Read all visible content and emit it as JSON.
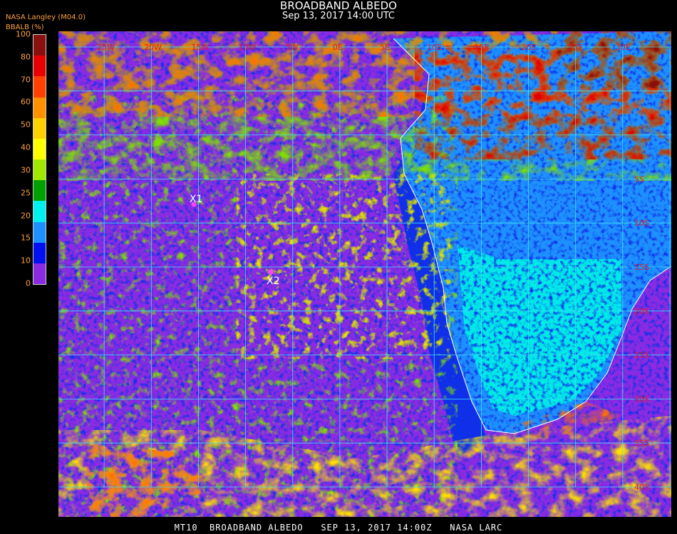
{
  "title": "BROADBAND ALBEDO",
  "subtitle": "Sep 13, 2017 14:00 UTC",
  "source_label": "NASA Langley (M04.0)",
  "unit_label": "BBALB (%)",
  "footer": "MT10  BROADBAND ALBEDO   SEP 13, 2017 14:00Z   NASA LARC",
  "colorbar": {
    "ticks": [
      "100",
      "80",
      "70",
      "60",
      "50",
      "40",
      "30",
      "25",
      "20",
      "15",
      "10",
      "0"
    ],
    "colors": [
      "#8a1010",
      "#e80000",
      "#ff4000",
      "#ff9000",
      "#ffd000",
      "#ffff00",
      "#a0e800",
      "#00a000",
      "#00f0f0",
      "#1e90ff",
      "#0010f0",
      "#8a2be2"
    ]
  },
  "map": {
    "lat_labels": [
      "5S",
      "10S",
      "15S",
      "20S",
      "25S",
      "30S",
      "35S",
      "40S"
    ],
    "lon_labels": [
      "25W",
      "20W",
      "15W",
      "10W",
      "5W",
      "0E",
      "5E",
      "10E",
      "15E",
      "20E",
      "25E",
      "30E"
    ],
    "markers": [
      {
        "label": "X1",
        "color": "#ff40ff"
      },
      {
        "label": "X2",
        "color": "#ff40ff"
      }
    ],
    "colors": {
      "ocean": "#8a2be2",
      "low_cloud": "#1030e8",
      "land": "#1e90ff",
      "desert": "#00e8e8",
      "cloud_green": "#7fe000",
      "cloud_yellow": "#ffe000",
      "cloud_orange": "#ff7000",
      "cloud_red": "#e00000",
      "grid": "#40e0f0"
    }
  }
}
